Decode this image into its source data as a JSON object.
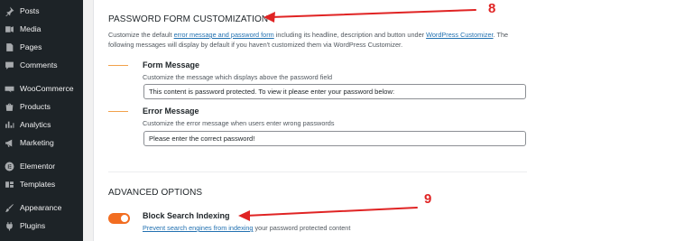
{
  "sidebar": {
    "items": [
      {
        "label": "Posts",
        "icon": "pin-icon"
      },
      {
        "label": "Media",
        "icon": "media-icon"
      },
      {
        "label": "Pages",
        "icon": "pages-icon"
      },
      {
        "label": "Comments",
        "icon": "comments-icon"
      },
      {
        "label": "WooCommerce",
        "icon": "woocommerce-icon"
      },
      {
        "label": "Products",
        "icon": "products-icon"
      },
      {
        "label": "Analytics",
        "icon": "analytics-icon"
      },
      {
        "label": "Marketing",
        "icon": "megaphone-icon"
      },
      {
        "label": "Elementor",
        "icon": "elementor-icon"
      },
      {
        "label": "Templates",
        "icon": "templates-icon"
      },
      {
        "label": "Appearance",
        "icon": "paintbrush-icon"
      },
      {
        "label": "Plugins",
        "icon": "plugin-icon"
      }
    ]
  },
  "password_form": {
    "title": "PASSWORD FORM CUSTOMIZATION",
    "desc_part1": "Customize the default ",
    "desc_link1": "error message and password form",
    "desc_part2": " including its headline, description and button under ",
    "desc_link2": "WordPress Customizer",
    "desc_part3": ". The following messages will display by default if you haven't customized them via WordPress Customizer.",
    "form_message": {
      "label": "Form Message",
      "help": "Customize the message which displays above the password field",
      "value": "This content is password protected. To view it please enter your password below:"
    },
    "error_message": {
      "label": "Error Message",
      "help": "Customize the error message when users enter wrong passwords",
      "value": "Please enter the correct password!"
    }
  },
  "advanced": {
    "title": "ADVANCED OPTIONS",
    "block_search": {
      "label": "Block Search Indexing",
      "help_link": "Prevent search engines from indexing",
      "help_rest": " your password protected content",
      "enabled": true
    }
  },
  "annotations": {
    "first": "8",
    "second": "9",
    "color": "#e02424"
  },
  "colors": {
    "sidebar_bg": "#1d2327",
    "toggle_on": "#f26d21",
    "accent_line": "#f2a14b",
    "link": "#2271b1"
  }
}
